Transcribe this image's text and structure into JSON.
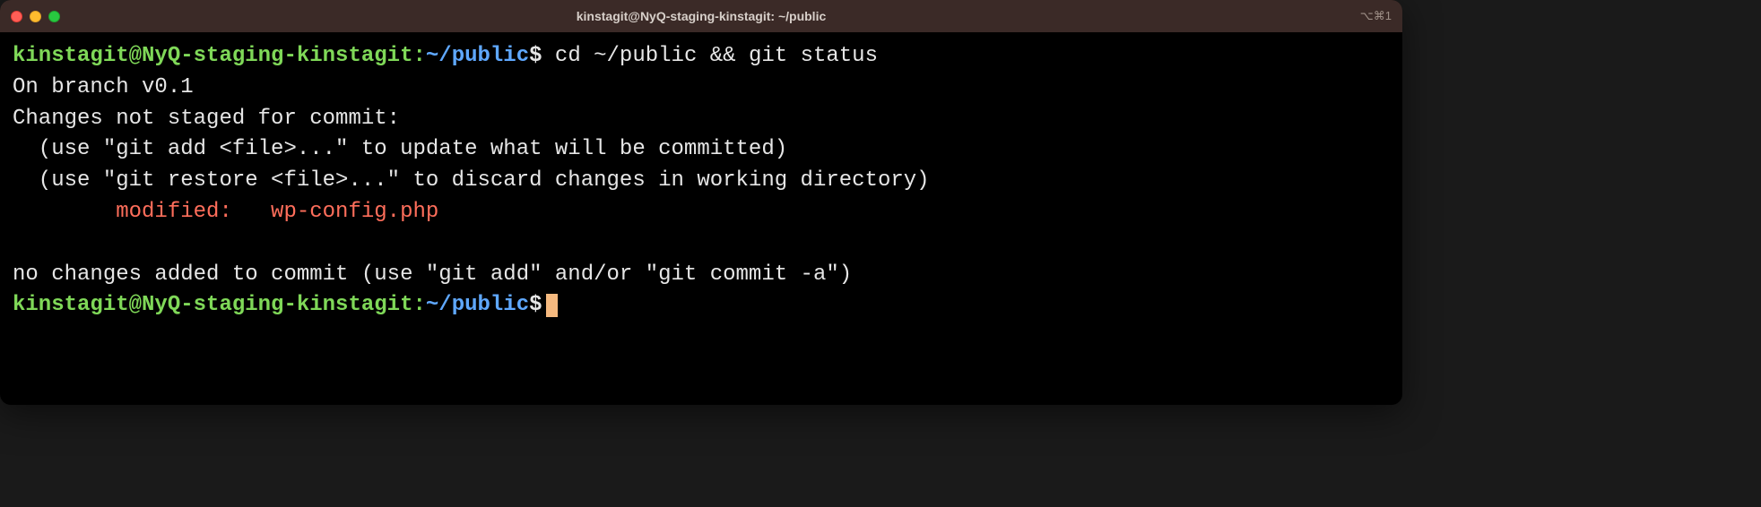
{
  "titlebar": {
    "title": "kinstagit@NyQ-staging-kinstagit: ~/public",
    "right_glyph": "⌥⌘1"
  },
  "prompt": {
    "userhost": "kinstagit@NyQ-staging-kinstagit",
    "sep": ":",
    "path": "~/public",
    "dollar": "$"
  },
  "command": "cd ~/public && git status",
  "output": {
    "l1": "On branch v0.1",
    "l2": "Changes not staged for commit:",
    "l3": "  (use \"git add <file>...\" to update what will be committed)",
    "l4": "  (use \"git restore <file>...\" to discard changes in working directory)",
    "l5": "        modified:   wp-config.php",
    "l6": "",
    "l7": "no changes added to commit (use \"git add\" and/or \"git commit -a\")"
  }
}
